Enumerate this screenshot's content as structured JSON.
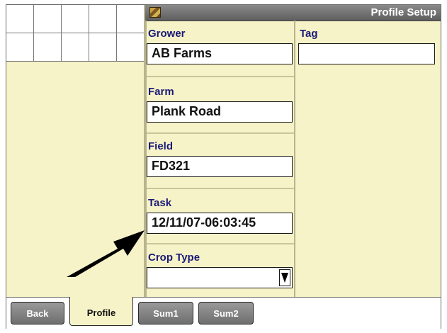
{
  "window": {
    "title": "Profile Setup",
    "icon": "application-icon"
  },
  "form": {
    "grower": {
      "label": "Grower",
      "value": "AB Farms"
    },
    "tag": {
      "label": "Tag",
      "value": ""
    },
    "farm": {
      "label": "Farm",
      "value": "Plank Road"
    },
    "field": {
      "label": "Field",
      "value": "FD321"
    },
    "task": {
      "label": "Task",
      "value": "12/11/07-06:03:45"
    },
    "crop_type": {
      "label": "Crop Type",
      "value": ""
    }
  },
  "tabs": [
    {
      "label": "Back"
    },
    {
      "label": "Profile",
      "active": true
    },
    {
      "label": "Sum1"
    },
    {
      "label": "Sum2"
    }
  ],
  "annotation": {
    "pointer": "arrow pointing to task field"
  }
}
